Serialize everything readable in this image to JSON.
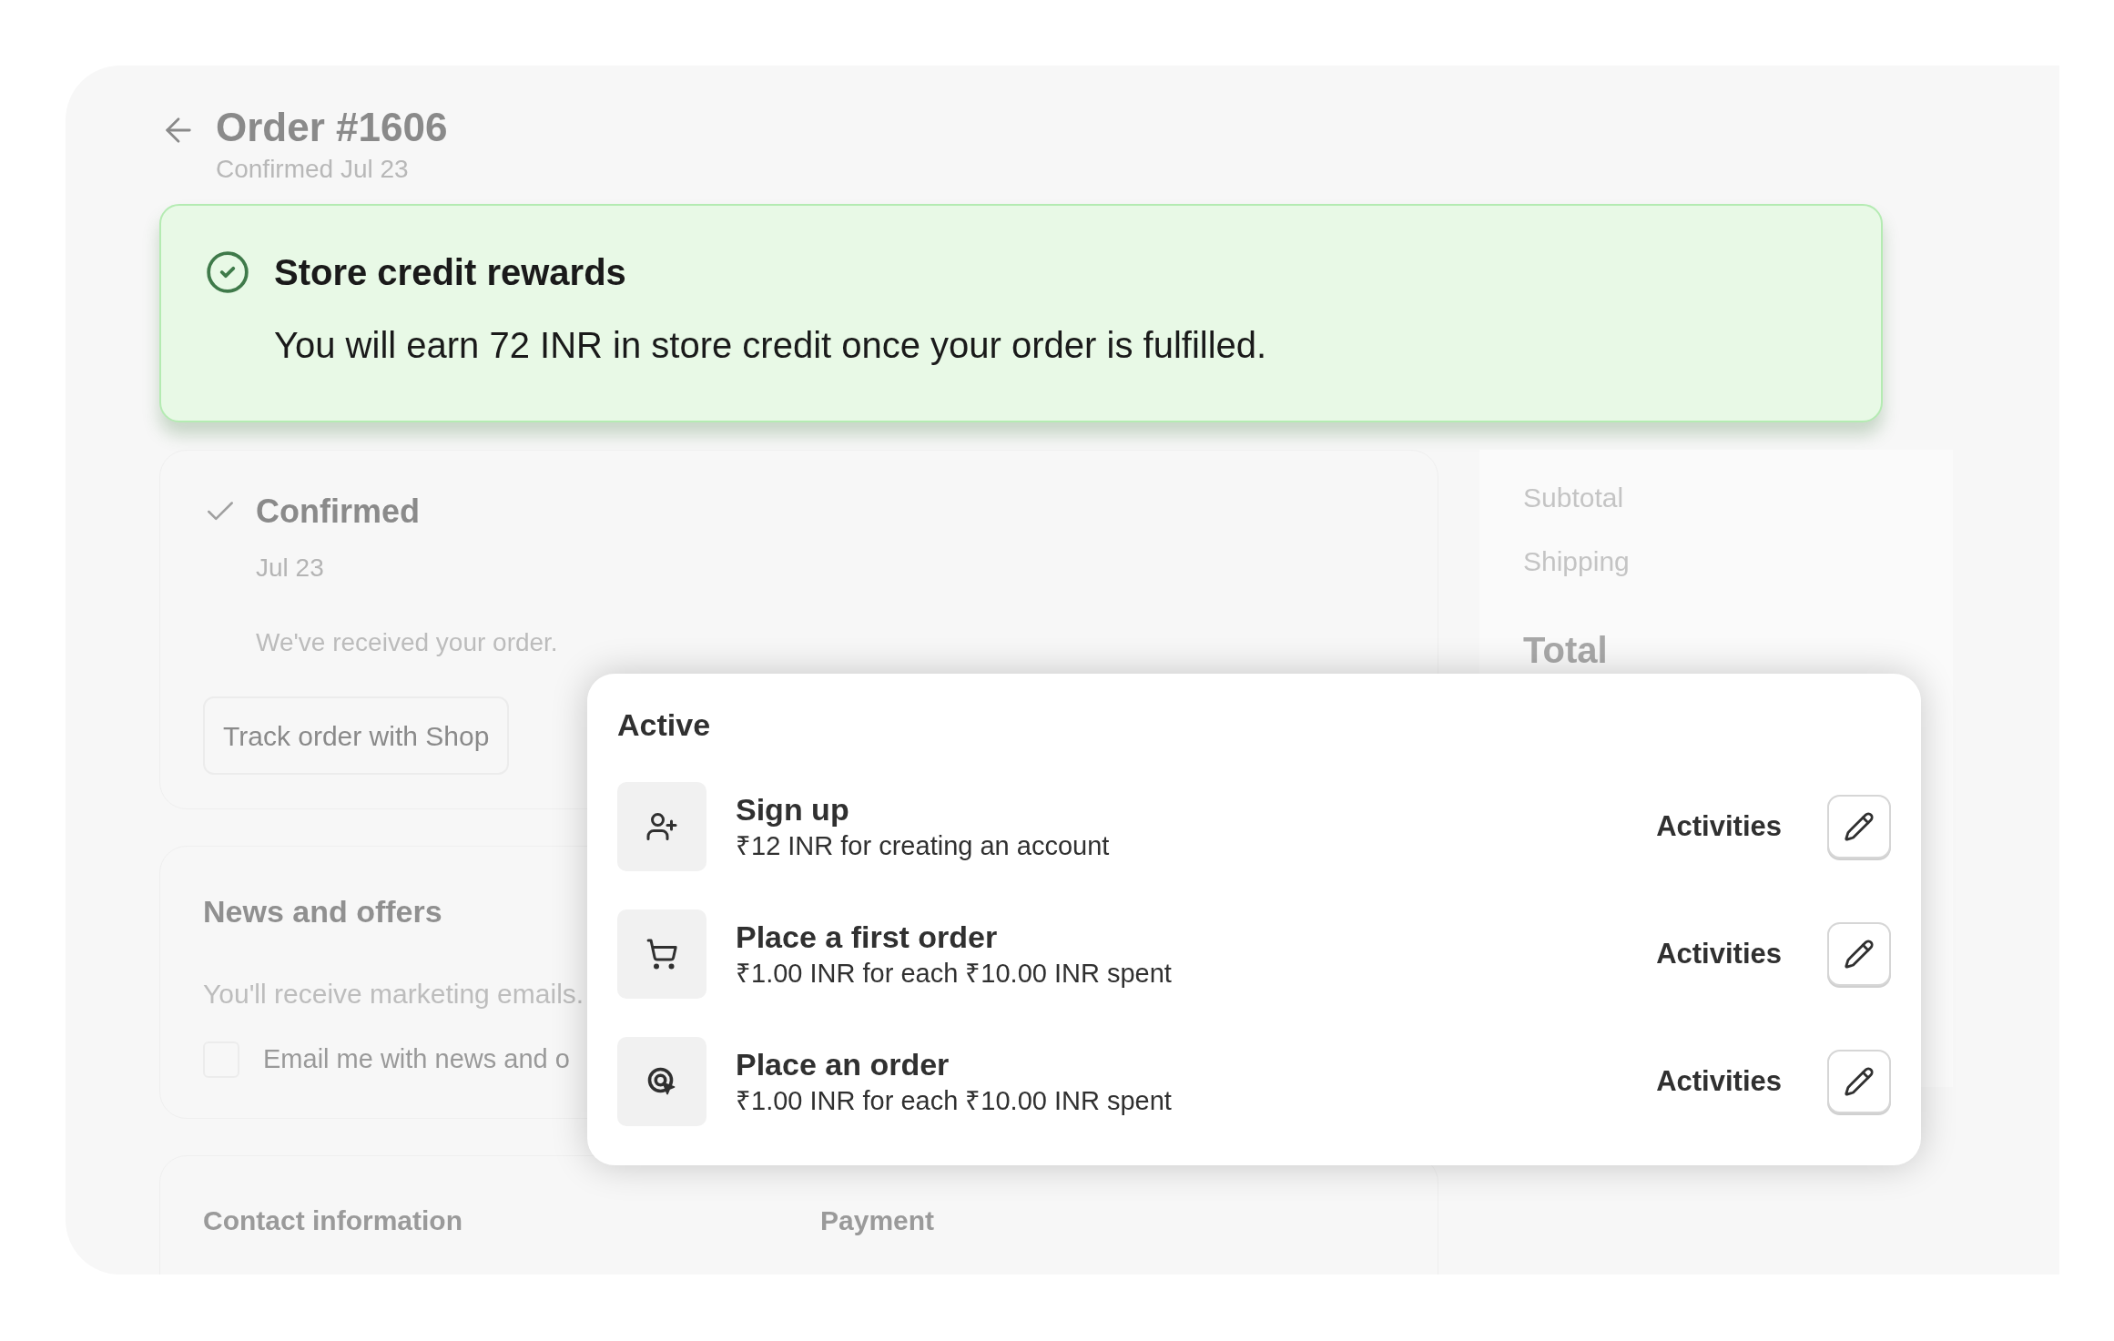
{
  "header": {
    "title": "Order #1606",
    "subtitle": "Confirmed Jul 23"
  },
  "banner": {
    "title": "Store credit rewards",
    "message": "You will earn 72 INR in store credit once your order is fulfilled."
  },
  "status": {
    "label": "Confirmed",
    "date": "Jul 23",
    "message": "We've received your order.",
    "button": "Track order with Shop"
  },
  "summary": {
    "rows": [
      "Subtotal",
      "Shipping"
    ],
    "total": "Total"
  },
  "news": {
    "title": "News and offers",
    "description": "You'll receive marketing emails.",
    "checkbox": {
      "label": "Email me with news and o",
      "checked": false
    }
  },
  "contact": {
    "columns": [
      "Contact information",
      "Payment"
    ]
  },
  "popup": {
    "title": "Active",
    "items": [
      {
        "kind": "signup",
        "title": "Sign up",
        "subtitle": "₹12 INR for creating an account",
        "link": "Activities"
      },
      {
        "kind": "cart",
        "title": "Place a first order",
        "subtitle": "₹1.00 INR for each ₹10.00 INR spent",
        "link": "Activities"
      },
      {
        "kind": "target",
        "title": "Place an order",
        "subtitle": "₹1.00 INR for each ₹10.00 INR spent",
        "link": "Activities"
      }
    ]
  }
}
